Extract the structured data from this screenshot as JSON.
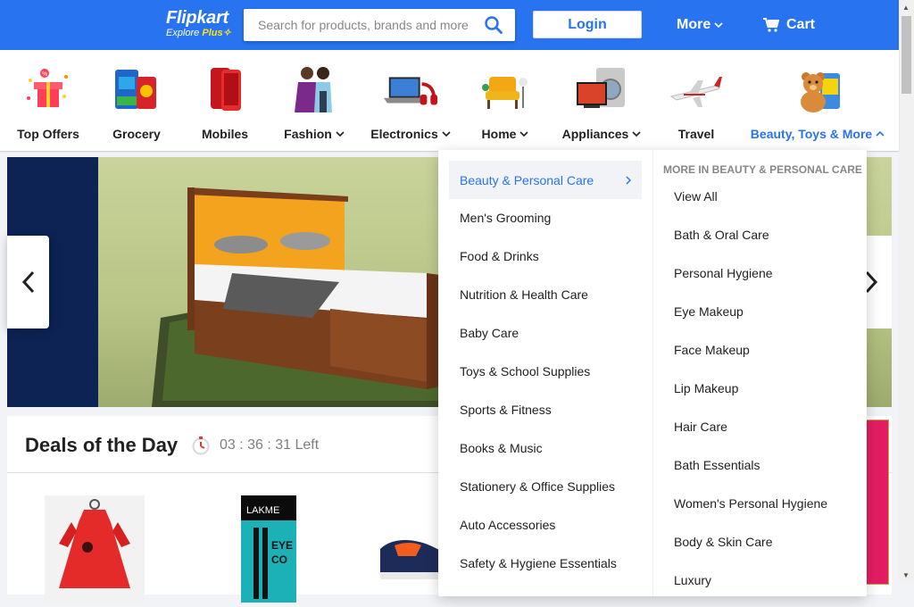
{
  "header": {
    "logo": "Flipkart",
    "logo_sub_prefix": "Explore ",
    "logo_sub_plus": "Plus",
    "search_placeholder": "Search for products, brands and more",
    "login_label": "Login",
    "more_label": "More",
    "cart_label": "Cart"
  },
  "categories": [
    {
      "label": "Top Offers",
      "icon": "offers-icon"
    },
    {
      "label": "Grocery",
      "icon": "grocery-icon"
    },
    {
      "label": "Mobiles",
      "icon": "mobile-icon"
    },
    {
      "label": "Fashion",
      "icon": "fashion-icon"
    },
    {
      "label": "Electronics",
      "icon": "laptop-icon"
    },
    {
      "label": "Home",
      "icon": "sofa-icon"
    },
    {
      "label": "Appliances",
      "icon": "appliance-icon"
    },
    {
      "label": "Travel",
      "icon": "airplane-icon"
    },
    {
      "label": "Beauty, Toys & More",
      "icon": "teddy-icon"
    }
  ],
  "deals": {
    "title": "Deals of the Day",
    "timer": "03 : 36 : 31 Left"
  },
  "dropdown": {
    "left_items": [
      "Beauty & Personal Care",
      "Men's Grooming",
      "Food & Drinks",
      "Nutrition & Health Care",
      "Baby Care",
      "Toys & School Supplies",
      "Sports & Fitness",
      "Books & Music",
      "Stationery & Office Supplies",
      "Auto Accessories",
      "Safety & Hygiene Essentials"
    ],
    "right_heading": "MORE IN BEAUTY & PERSONAL CARE",
    "right_items": [
      "View All",
      "Bath & Oral Care",
      "Personal Hygiene",
      "Eye Makeup",
      "Face Makeup",
      "Lip Makeup",
      "Hair Care",
      "Bath Essentials",
      "Women's Personal Hygiene",
      "Body & Skin Care",
      "Luxury"
    ]
  },
  "colors": {
    "brand_blue": "#2874f0",
    "accent_yellow": "#ffe11b"
  }
}
